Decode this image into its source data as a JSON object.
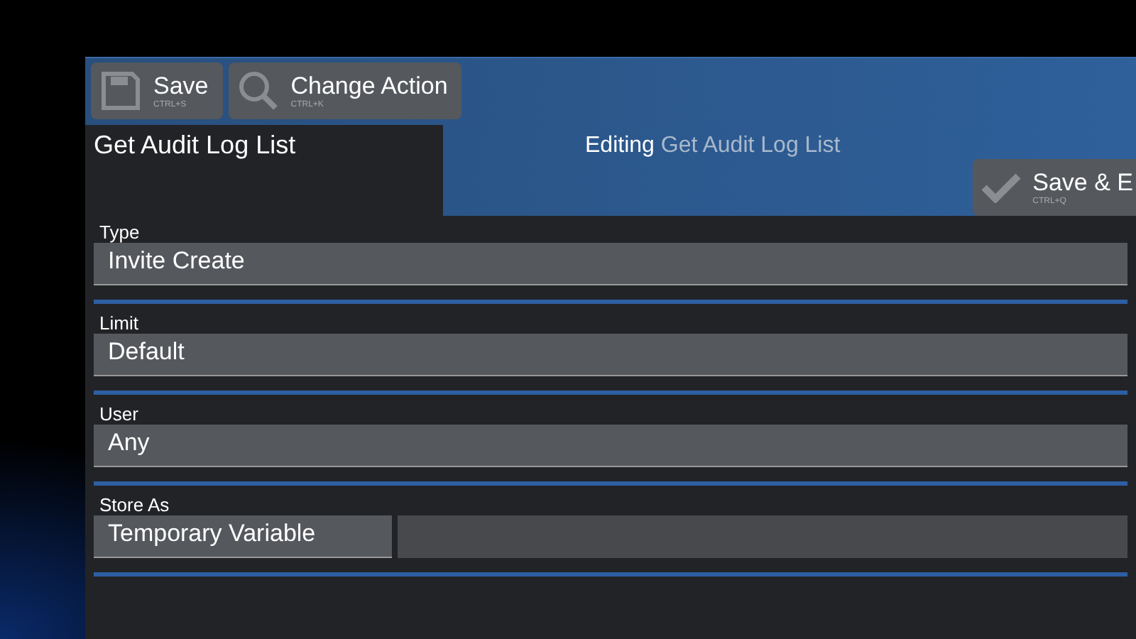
{
  "toolbar": {
    "buttons": [
      {
        "kind": "save",
        "label": "Save",
        "shortcut": "CTRL+S"
      },
      {
        "kind": "search",
        "label": "Change Action",
        "shortcut": "CTRL+K"
      }
    ]
  },
  "title": "Get Audit Log List",
  "editing": {
    "prefix": "Editing",
    "name": "Get Audit Log List"
  },
  "save_exit": {
    "label": "Save & E",
    "shortcut": "CTRL+Q"
  },
  "fields": [
    {
      "label": "Type",
      "value": "Invite Create"
    },
    {
      "label": "Limit",
      "value": "Default"
    },
    {
      "label": "User",
      "value": "Any"
    },
    {
      "label": "Store As",
      "value": "Temporary Variable",
      "kind": "split"
    }
  ]
}
